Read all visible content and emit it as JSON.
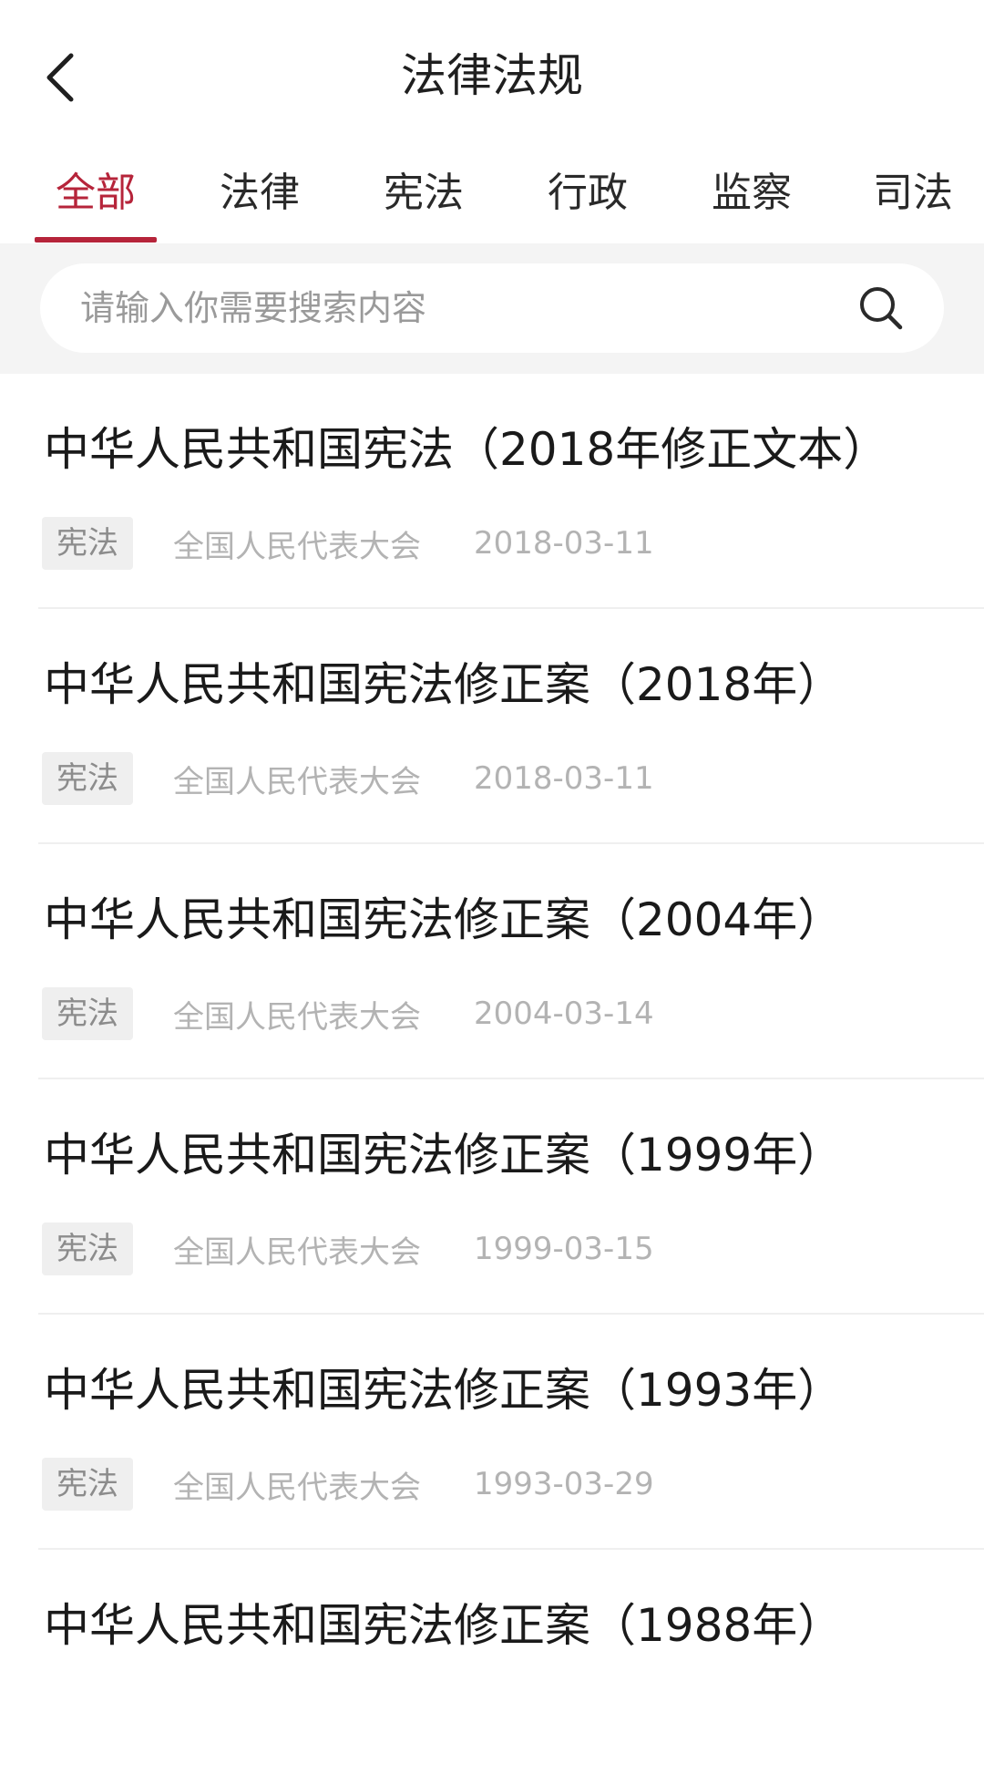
{
  "header": {
    "title": "法律法规",
    "back_icon": "chevron-left-icon"
  },
  "tabs": [
    {
      "label": "全部",
      "active": true
    },
    {
      "label": "法律",
      "active": false
    },
    {
      "label": "宪法",
      "active": false
    },
    {
      "label": "行政",
      "active": false
    },
    {
      "label": "监察",
      "active": false
    },
    {
      "label": "司法",
      "active": false
    }
  ],
  "colors": {
    "accent": "#b6243a",
    "muted_text": "#b3b3b3",
    "tag_bg": "#efefef",
    "search_bg": "#f4f4f4"
  },
  "search": {
    "placeholder": "请输入你需要搜索内容",
    "value": "",
    "icon": "search-icon"
  },
  "items": [
    {
      "title": "中华人民共和国宪法（2018年修正文本）",
      "tag": "宪法",
      "source": "全国人民代表大会",
      "date": "2018-03-11"
    },
    {
      "title": "中华人民共和国宪法修正案（2018年）",
      "tag": "宪法",
      "source": "全国人民代表大会",
      "date": "2018-03-11"
    },
    {
      "title": "中华人民共和国宪法修正案（2004年）",
      "tag": "宪法",
      "source": "全国人民代表大会",
      "date": "2004-03-14"
    },
    {
      "title": "中华人民共和国宪法修正案（1999年）",
      "tag": "宪法",
      "source": "全国人民代表大会",
      "date": "1999-03-15"
    },
    {
      "title": "中华人民共和国宪法修正案（1993年）",
      "tag": "宪法",
      "source": "全国人民代表大会",
      "date": "1993-03-29"
    },
    {
      "title": "中华人民共和国宪法修正案（1988年）",
      "tag": "",
      "source": "",
      "date": ""
    }
  ]
}
